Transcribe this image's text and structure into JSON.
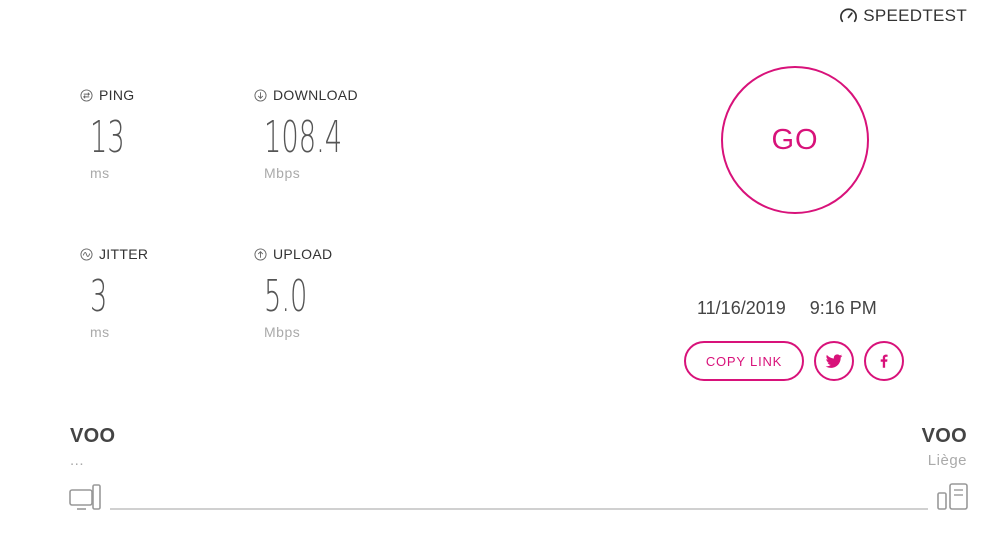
{
  "brand": {
    "name": "SPEEDTEST",
    "icon": "gauge-icon"
  },
  "metrics": {
    "ping": {
      "label": "PING",
      "value": "13",
      "unit": "ms",
      "icon": "ping-icon"
    },
    "download": {
      "label": "DOWNLOAD",
      "value": "108.4",
      "unit": "Mbps",
      "icon": "download-arrow-icon"
    },
    "jitter": {
      "label": "JITTER",
      "value": "3",
      "unit": "ms",
      "icon": "jitter-icon"
    },
    "upload": {
      "label": "UPLOAD",
      "value": "5.0",
      "unit": "Mbps",
      "icon": "upload-arrow-icon"
    }
  },
  "go_button": {
    "label": "GO"
  },
  "result": {
    "date": "11/16/2019",
    "time": "9:16 PM"
  },
  "share": {
    "copy_link_label": "COPY LINK",
    "twitter_icon": "twitter-icon",
    "facebook_icon": "facebook-icon"
  },
  "connection": {
    "isp_name": "VOO",
    "isp_detail": "...",
    "server_name": "VOO",
    "server_location": "Liège",
    "client_icon": "computer-icon",
    "server_icon": "server-icon"
  },
  "colors": {
    "accent": "#d8127a",
    "text": "#333333",
    "muted": "#aaaaaa",
    "line": "#d0d0d0"
  }
}
